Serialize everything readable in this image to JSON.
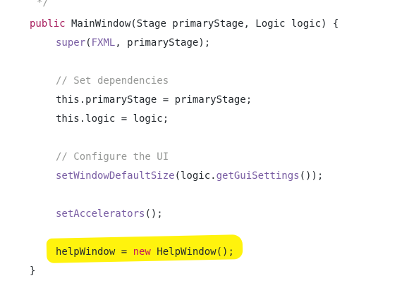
{
  "code_lines": [
    {
      "id": "comment-close",
      "tokens": [
        {
          "cls": "cm",
          "text": "*/"
        }
      ]
    },
    {
      "id": "constructor-signature",
      "tokens": [
        {
          "cls": "kw",
          "text": "public"
        },
        {
          "cls": "pl",
          "text": " MainWindow(Stage primaryStage, Logic logic) {"
        }
      ]
    },
    {
      "id": "super-call",
      "tokens": [
        {
          "cls": "fn",
          "text": "super"
        },
        {
          "cls": "pl",
          "text": "("
        },
        {
          "cls": "fn",
          "text": "FXML"
        },
        {
          "cls": "pl",
          "text": ", primaryStage);"
        }
      ]
    },
    {
      "id": "comment-dependencies",
      "tokens": [
        {
          "cls": "cm",
          "text": "// Set dependencies"
        }
      ]
    },
    {
      "id": "assign-stage",
      "tokens": [
        {
          "cls": "pl",
          "text": "this.primaryStage = primaryStage;"
        }
      ]
    },
    {
      "id": "assign-logic",
      "tokens": [
        {
          "cls": "pl",
          "text": "this.logic = logic;"
        }
      ]
    },
    {
      "id": "comment-configure",
      "tokens": [
        {
          "cls": "cm",
          "text": "// Configure the UI"
        }
      ]
    },
    {
      "id": "set-size",
      "tokens": [
        {
          "cls": "fn",
          "text": "setWindowDefaultSize"
        },
        {
          "cls": "pl",
          "text": "(logic."
        },
        {
          "cls": "fn",
          "text": "getGuiSettings"
        },
        {
          "cls": "pl",
          "text": "());"
        }
      ]
    },
    {
      "id": "set-accelerators",
      "tokens": [
        {
          "cls": "fn",
          "text": "setAccelerators"
        },
        {
          "cls": "pl",
          "text": "();"
        }
      ]
    },
    {
      "id": "help-window",
      "tokens": [
        {
          "cls": "pl",
          "text": "helpWindow = "
        },
        {
          "cls": "new-kw",
          "text": "new"
        },
        {
          "cls": "pl",
          "text": " HelpWindow();"
        }
      ]
    },
    {
      "id": "closing-brace",
      "tokens": [
        {
          "cls": "pl",
          "text": "}"
        }
      ]
    }
  ],
  "colors": {
    "keyword": "#a71d5d",
    "function": "#795da3",
    "comment": "#969896",
    "plain": "#24292e",
    "highlight": "#fff200"
  }
}
